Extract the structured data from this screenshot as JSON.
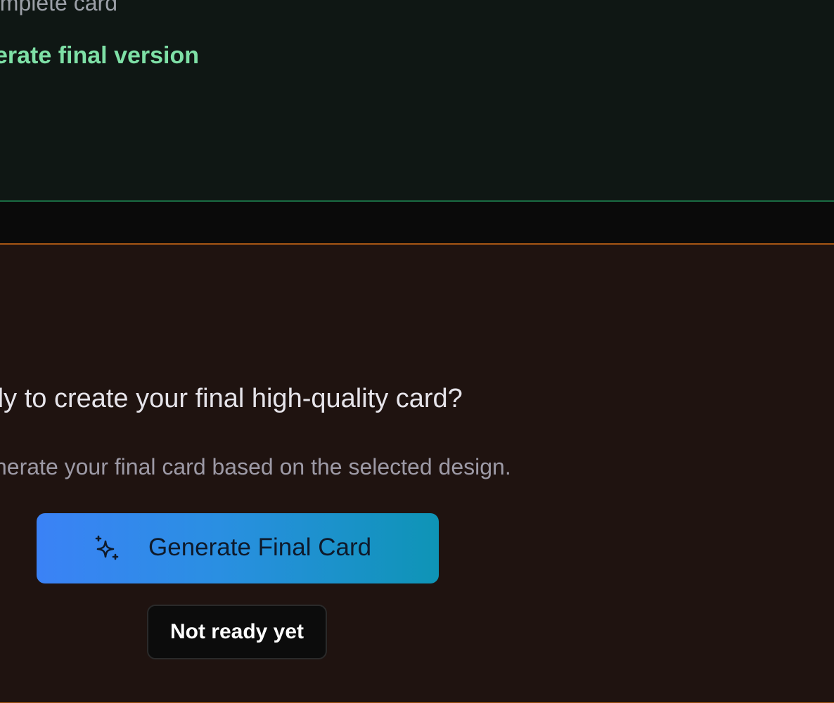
{
  "top_panel": {
    "line1": "omplete card",
    "line2": "erate final version"
  },
  "cta_panel": {
    "question": "dy to create your final high-quality card?",
    "subtext": "nerate your final card based on the selected design.",
    "generate_button": {
      "label": "Generate Final Card",
      "icon": "sparkles-icon"
    },
    "not_ready_button": {
      "label": "Not ready yet"
    }
  },
  "colors": {
    "green_text": "#7ee0a6",
    "green_border": "#1a6b43",
    "orange_border": "#a65614",
    "gradient_start": "#3b82f6",
    "gradient_end": "#0e94b6"
  }
}
